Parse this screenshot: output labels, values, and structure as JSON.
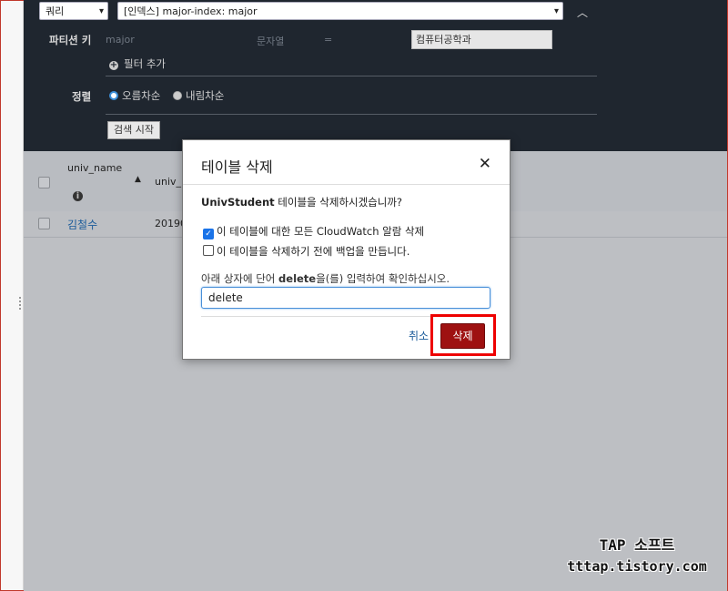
{
  "query_panel": {
    "mode_select": "쿼리",
    "index_select": "[인덱스] major-index: major",
    "partition_key_label": "파티션 키",
    "partition_key_name": "major",
    "partition_key_type": "문자열",
    "operator": "=",
    "partition_value": "컴퓨터공학과",
    "add_filter": "필터 추가",
    "sort_label": "정렬",
    "sort_asc": "오름차순",
    "sort_desc": "내림차순",
    "search_button": "검색 시작"
  },
  "table": {
    "columns": [
      "univ_name",
      "univ_"
    ],
    "rows": [
      {
        "univ_name": "김철수",
        "univ_id": "20190"
      }
    ]
  },
  "modal": {
    "title": "테이블 삭제",
    "message_table": "UnivStudent",
    "message_rest": " 테이블을 삭제하시겠습니까?",
    "option_cloudwatch": "이 테이블에 대한 모든 CloudWatch 알람 삭제",
    "option_cloudwatch_checked": true,
    "option_backup": "이 테이블을 삭제하기 전에 백업을 만듭니다.",
    "option_backup_checked": false,
    "instruction_pre": "아래 상자에 단어 ",
    "instruction_word": "delete",
    "instruction_post": "을(를) 입력하여 확인하십시오.",
    "confirm_value": "delete",
    "cancel_label": "취소",
    "delete_label": "삭제"
  },
  "watermark": {
    "line1": "TAP 소프트",
    "line2": "tttap.tistory.com"
  },
  "colors": {
    "accent_blue": "#1a73e8",
    "danger": "#9e1111",
    "highlight": "#e00000"
  }
}
